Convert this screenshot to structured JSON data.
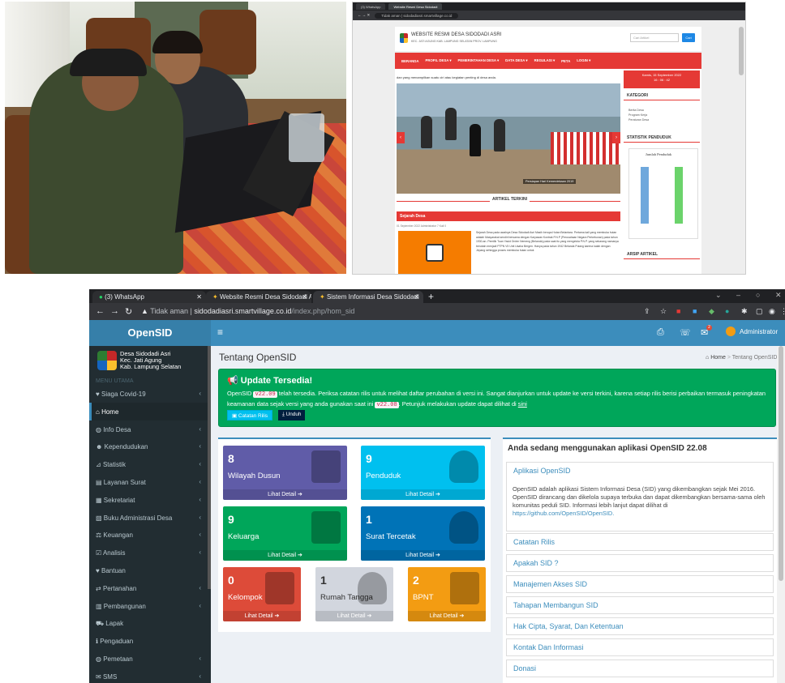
{
  "shot1": {
    "tabs": [
      "(3) WhatsApp",
      "Website Resmi Desa Sidodadi"
    ],
    "url_label": "Tidak aman",
    "url": "sidodadiasri.smartvillage.co.id",
    "site_title": "WEBSITE RESMI DESA SIDODADI ASRI",
    "site_subtitle": "KEC. JATI AGUNG KAB. LAMPUNG SELATAN PROV. LAMPUNG",
    "search_placeholder": "Cari Artikel",
    "search_button": "Cari",
    "nav": [
      "BERANDA",
      "PROFIL DESA ▾",
      "PEMERINTAHAN DESA ▾",
      "DATA DESA ▾",
      "REGULASI ▾",
      "PETA",
      "LOGIN ▾"
    ],
    "running_text": "dan yang menampilkan suatu ciri atau kegiatan penting di desa anda.",
    "slide_caption": "Persiapan Hari Kemerdekaan 2019",
    "section_title": "ARTIKEL TERKINI",
    "post_title": "Sejarah Desa",
    "post_meta": "01 September 2022  Administrator  7 Kali  0",
    "post_text": "Sejarah Desa pada awalnya Desa Sidodadi Asri Masih berupa Hutan Belantara. Pertama kali yang membuka hutan adalah Masyarakat sendiri bersama dengan Karyawan Kontrak P.N.P (Perusahaan Negara Perkebunan) pada tahun 1930-an. Pemilik Tuan Yasid Orden Nemeng (Belanda) pada saat itu yang mengelola P.N.P. yang sekarang namanya berubah menjadi PTPN VII Unit Usaha Bergen. Hanya pada tahun 1942 Belanda Pulang karena kalah dengan Jepang sehingga proses membuka hutan untuk",
    "date_line1": "Kamis, 15 September 2022",
    "date_line2": "16 : 06 : 42",
    "kategori_title": "KATEGORI",
    "kategori_items": [
      "Berita Desa",
      "Program Kerja",
      "Peraturan Desa"
    ],
    "statistik_title": "STATISTIK PENDUDUK",
    "chart_title": "Jumlah Penduduk",
    "arsip_title": "ARSIP ARTIKEL"
  },
  "shot2": {
    "tabs": [
      {
        "label": "(3) WhatsApp"
      },
      {
        "label": "Website Resmi Desa Sidodadi As"
      },
      {
        "label": "Sistem Informasi Desa Sidodadi"
      }
    ],
    "url_insecure": "Tidak aman",
    "url_host": "sidodadiasri.smartvillage.co.id",
    "url_path": "/index.php/hom_sid",
    "brand": "OpenSID",
    "admin": "Administrator",
    "notif_count": "2",
    "village": {
      "name": "Desa Sidodadi Asri",
      "kec": "Kec. Jati Agung",
      "kab": "Kab. Lampung Selatan"
    },
    "menu_header": "MENU UTAMA",
    "menu": [
      {
        "label": "Siaga Covid-19",
        "icon": "heart-icon",
        "chevron": "‹"
      },
      {
        "label": "Home",
        "icon": "home-icon",
        "chevron": ""
      },
      {
        "label": "Info Desa",
        "icon": "globe-icon",
        "chevron": "‹"
      },
      {
        "label": "Kependudukan",
        "icon": "users-icon",
        "chevron": "‹"
      },
      {
        "label": "Statistik",
        "icon": "chart-icon",
        "chevron": "‹"
      },
      {
        "label": "Layanan Surat",
        "icon": "book-icon",
        "chevron": "‹"
      },
      {
        "label": "Sekretariat",
        "icon": "archive-icon",
        "chevron": "‹"
      },
      {
        "label": "Buku Administrasi Desa",
        "icon": "copy-icon",
        "chevron": "‹"
      },
      {
        "label": "Keuangan",
        "icon": "balance-icon",
        "chevron": "‹"
      },
      {
        "label": "Analisis",
        "icon": "check-icon",
        "chevron": "‹"
      },
      {
        "label": "Bantuan",
        "icon": "heart-icon",
        "chevron": ""
      },
      {
        "label": "Pertanahan",
        "icon": "map-signs-icon",
        "chevron": "‹"
      },
      {
        "label": "Pembangunan",
        "icon": "building-icon",
        "chevron": "‹"
      },
      {
        "label": "Lapak",
        "icon": "cart-icon",
        "chevron": ""
      },
      {
        "label": "Pengaduan",
        "icon": "info-icon",
        "chevron": ""
      },
      {
        "label": "Pemetaan",
        "icon": "globe-icon",
        "chevron": "‹"
      },
      {
        "label": "SMS",
        "icon": "envelope-icon",
        "chevron": "‹"
      }
    ],
    "page_title": "Tentang OpenSID",
    "breadcrumb_home": "Home",
    "breadcrumb_current": "Tentang OpenSID",
    "update": {
      "title": "Update Tersedia!",
      "t1": "OpenSID",
      "version": "v22.09",
      "t2": "telah tersedia. Periksa catatan rilis untuk melihat daftar perubahan di versi ini. Sangat dianjurkan untuk update ke versi terkini, karena setiap rilis berisi perbaikan termasuk peningkatan keamanan data sejak versi yang anda gunakan saat ini",
      "current": "v22.08",
      "t3": ". Petunjuk melakukan update dapat dilihat di",
      "link": "sini",
      "btn_release": "Catatan Rilis",
      "btn_download": "Unduh"
    },
    "stats": [
      {
        "num": "8",
        "label": "Wilayah Dusun",
        "footer": "Lihat Detail ➔",
        "color": "#605ca8"
      },
      {
        "num": "9",
        "label": "Penduduk",
        "footer": "Lihat Detail ➔",
        "color": "#00c0ef"
      },
      {
        "num": "9",
        "label": "Keluarga",
        "footer": "Lihat Detail ➔",
        "color": "#00a65a"
      },
      {
        "num": "1",
        "label": "Surat Tercetak",
        "footer": "Lihat Detail ➔",
        "color": "#0073b7"
      },
      {
        "num": "0",
        "label": "Kelompok",
        "footer": "Lihat Detail ➔",
        "color": "#dd4b39"
      },
      {
        "num": "1",
        "label": "Rumah Tangga",
        "footer": "Lihat Detail ➔",
        "color": "#d2d6de"
      },
      {
        "num": "2",
        "label": "BPNT",
        "footer": "Lihat Detail ➔",
        "color": "#f39c12"
      }
    ],
    "about": {
      "title": "Anda sedang menggunakan aplikasi OpenSID 22.08",
      "sections": [
        "Aplikasi OpenSID",
        "Catatan Rilis",
        "Apakah SID ?",
        "Manajemen Akses SID",
        "Tahapan Membangun SID",
        "Hak Cipta, Syarat, Dan Ketentuan",
        "Kontak Dan Informasi",
        "Donasi"
      ],
      "body": "OpenSID adalah aplikasi Sistem Informasi Desa (SID) yang dikembangkan sejak Mei 2016. OpenSID dirancang dan dikelola supaya terbuka dan dapat dikembangkan bersama-sama oleh komunitas peduli SID. Informasi lebih lanjut dapat dilihat di",
      "link": "https://github.com/OpenSID/OpenSID."
    }
  }
}
